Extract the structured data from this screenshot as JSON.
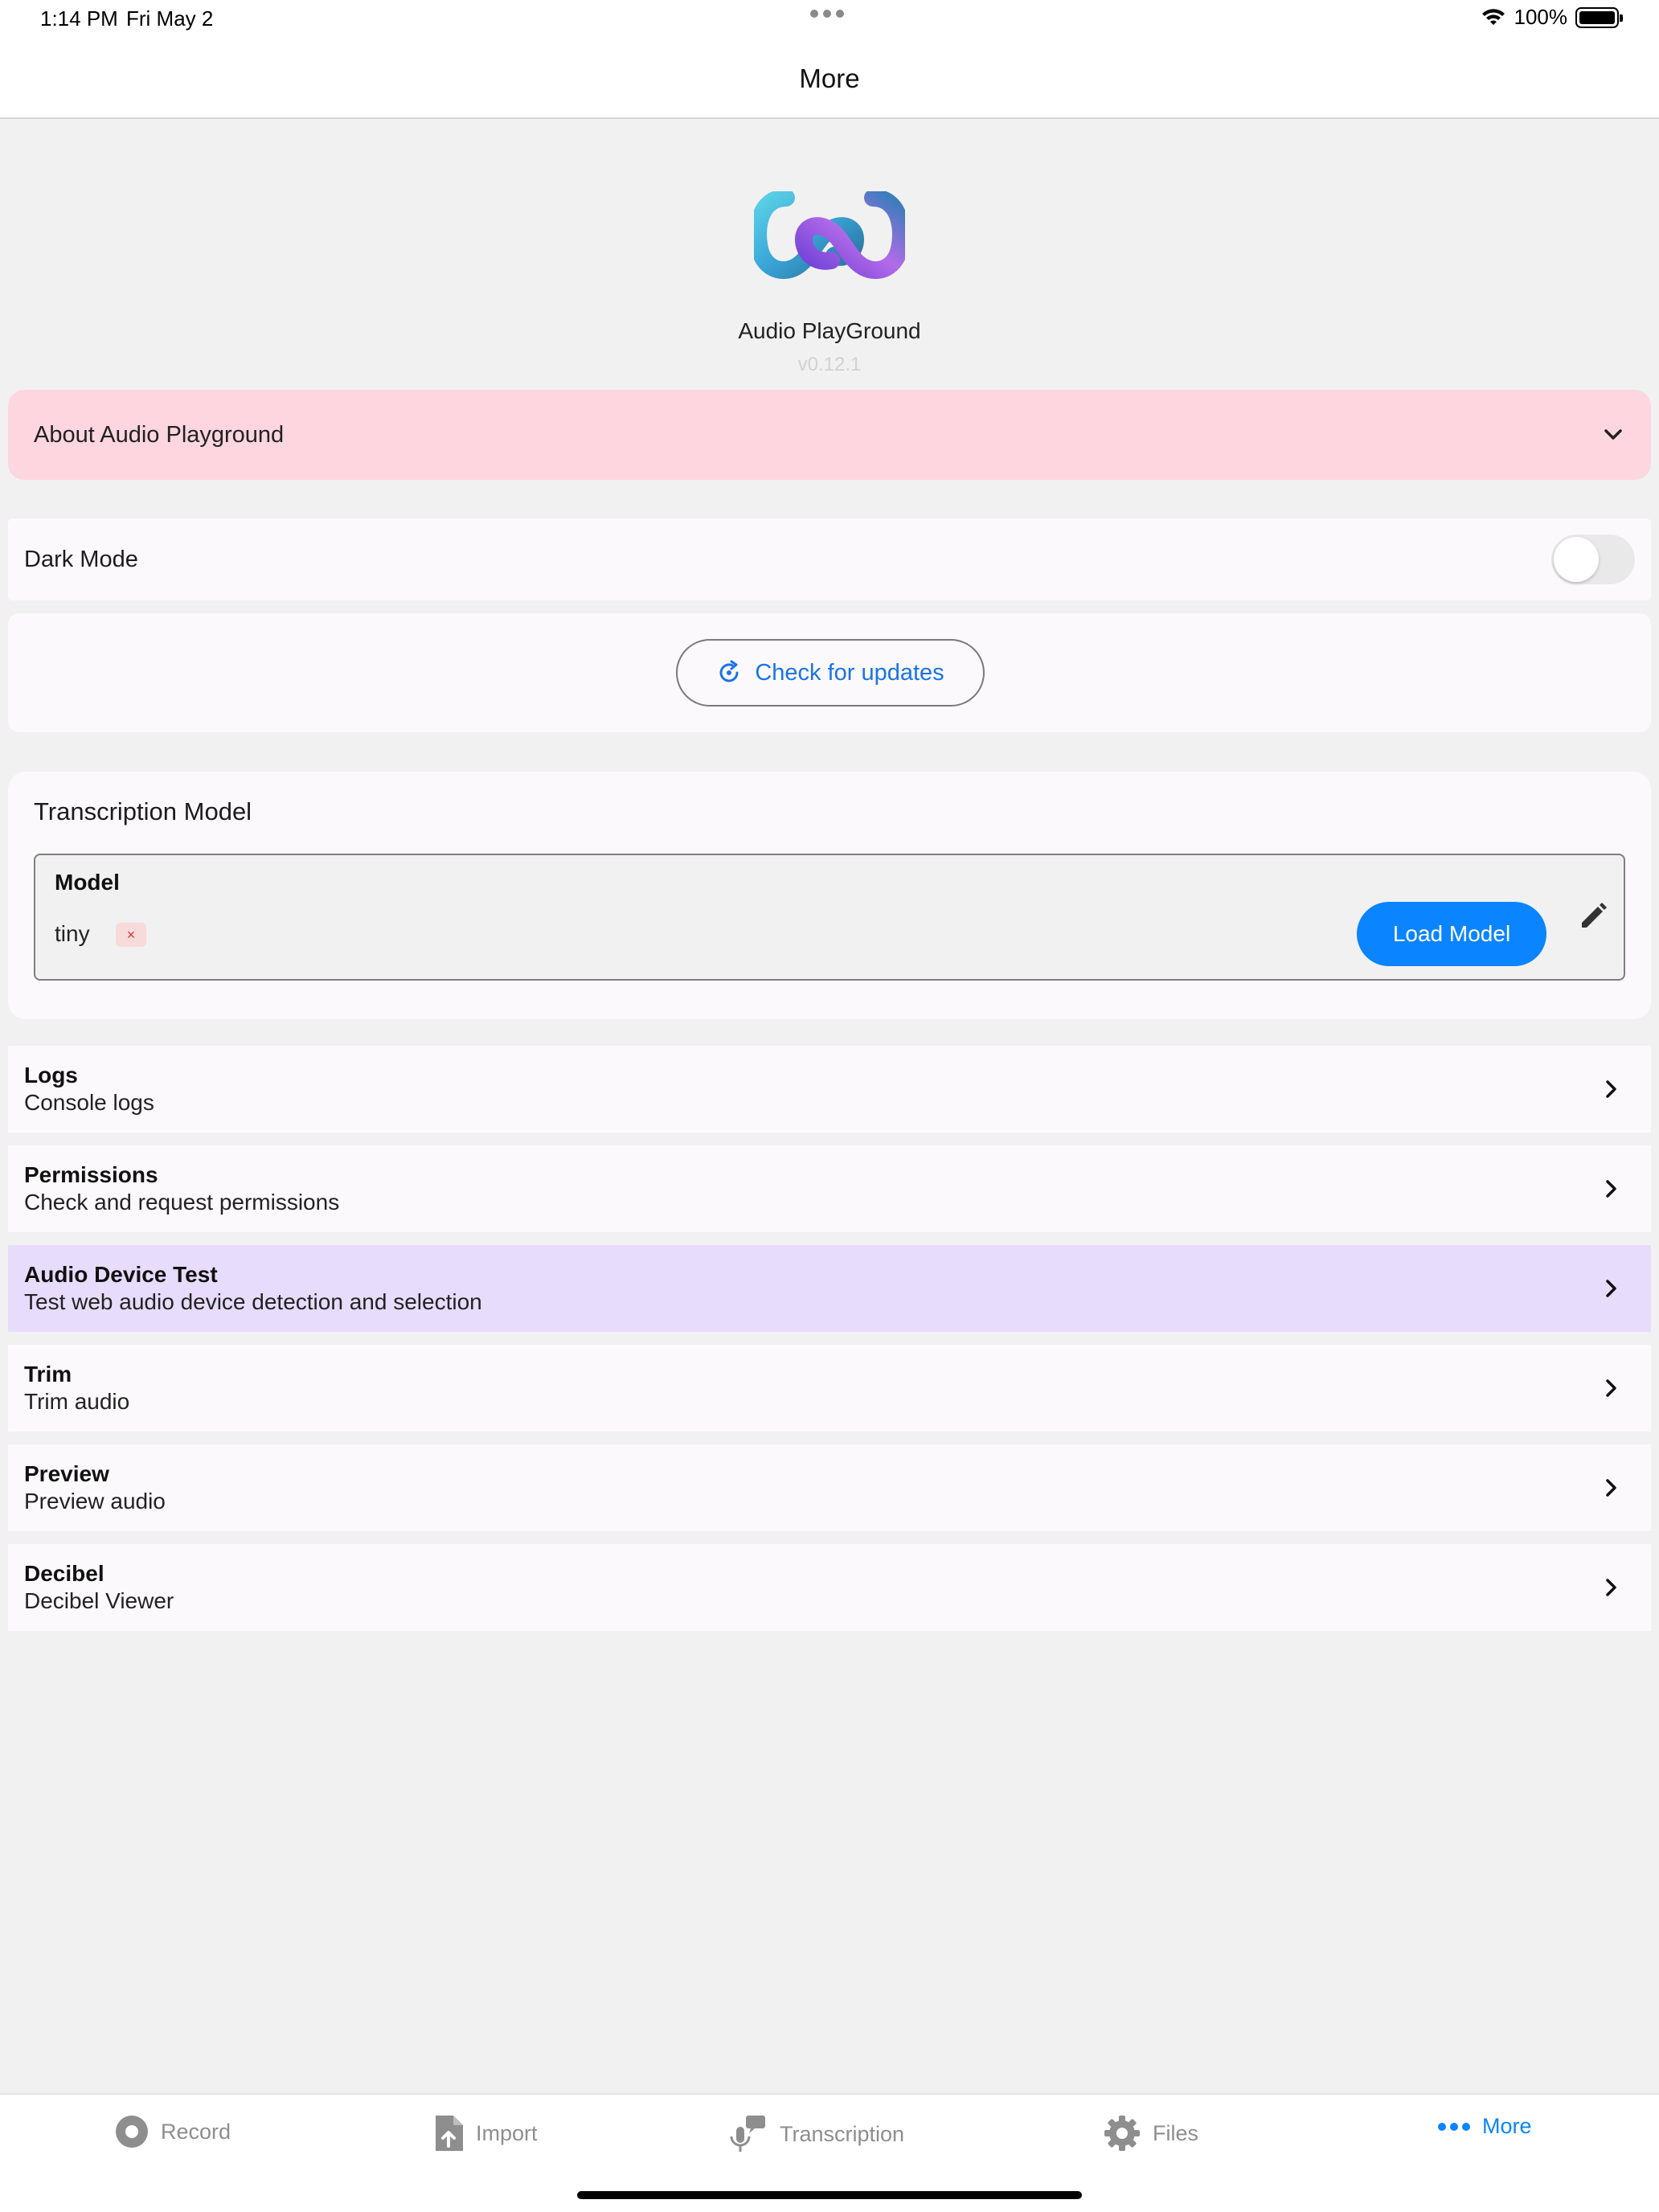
{
  "status_bar": {
    "time": "1:14 PM",
    "date": "Fri May 2",
    "battery": "100%"
  },
  "header": {
    "title": "More"
  },
  "app": {
    "name": "Audio PlayGround",
    "version": "v0.12.1"
  },
  "about": {
    "label": "About Audio Playground"
  },
  "settings": {
    "dark_mode_label": "Dark Mode",
    "dark_mode_enabled": false,
    "check_updates_label": "Check for updates"
  },
  "transcription": {
    "section_title": "Transcription Model",
    "model_label": "Model",
    "model_value": "tiny",
    "clear_symbol": "×",
    "load_button": "Load Model"
  },
  "menu": [
    {
      "title": "Logs",
      "subtitle": "Console logs"
    },
    {
      "title": "Permissions",
      "subtitle": "Check and request permissions"
    },
    {
      "title": "Audio Device Test",
      "subtitle": "Test web audio device detection and selection"
    },
    {
      "title": "Trim",
      "subtitle": "Trim audio"
    },
    {
      "title": "Preview",
      "subtitle": "Preview audio"
    },
    {
      "title": "Decibel",
      "subtitle": "Decibel Viewer"
    }
  ],
  "tabs": [
    {
      "label": "Record",
      "icon": "record-icon"
    },
    {
      "label": "Import",
      "icon": "import-file-icon"
    },
    {
      "label": "Transcription",
      "icon": "transcription-icon"
    },
    {
      "label": "Files",
      "icon": "gear-icon"
    },
    {
      "label": "More",
      "icon": "more-dots-icon",
      "active": true
    }
  ],
  "colors": {
    "accent": "#0a84ff",
    "about_bg": "#fdd6e0",
    "highlight_row": "#e8dcfd"
  }
}
